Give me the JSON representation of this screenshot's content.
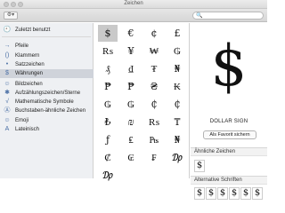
{
  "window": {
    "title": "Zeichen"
  },
  "toolbar": {
    "gear_label": "⚙▾",
    "search_placeholder": ""
  },
  "sidebar": {
    "items": [
      {
        "icon": "🕘",
        "icon_name": "clock-icon",
        "label": "Zuletzt benutzt",
        "selected": false
      },
      {
        "icon": "→",
        "icon_name": "arrow-icon",
        "label": "Pfeile",
        "selected": false
      },
      {
        "icon": "()",
        "icon_name": "parentheses-icon",
        "label": "Klammern",
        "selected": false
      },
      {
        "icon": "•",
        "icon_name": "bullet-icon",
        "label": "Satzzeichen",
        "selected": false
      },
      {
        "icon": "$",
        "icon_name": "dollar-icon",
        "label": "Währungen",
        "selected": true
      },
      {
        "icon": "☺",
        "icon_name": "pictograph-icon",
        "label": "Bildzeichen",
        "selected": false
      },
      {
        "icon": "✱",
        "icon_name": "star-icon",
        "label": "Aufzählungszeichen/Sterne",
        "selected": false
      },
      {
        "icon": "√",
        "icon_name": "math-icon",
        "label": "Mathematische Symbole",
        "selected": false
      },
      {
        "icon": "Ⓐ",
        "icon_name": "letterlike-icon",
        "label": "Buchstaben-ähnliche Zeichen",
        "selected": false
      },
      {
        "icon": "☺",
        "icon_name": "emoji-icon",
        "label": "Emoji",
        "selected": false
      },
      {
        "icon": "A",
        "icon_name": "latin-icon",
        "label": "Lateinisch",
        "selected": false
      }
    ]
  },
  "grid": {
    "rows": [
      [
        "$",
        "€",
        "¢",
        "£"
      ],
      [
        "₨",
        "¥",
        "₩",
        "₲"
      ],
      [
        "₰",
        "₫",
        "₮",
        "₦"
      ],
      [
        "₱",
        "₱",
        "₴",
        "₭"
      ],
      [
        "₲",
        "₲",
        "₵",
        "₵"
      ],
      [
        "₺",
        "₪",
        "₨",
        "₸"
      ],
      [
        "ƒ",
        "₤",
        "₧",
        "₦"
      ],
      [
        "₡",
        "₢",
        "₣",
        "₯"
      ],
      [
        "₯",
        "",
        "",
        ""
      ]
    ],
    "selected": [
      0,
      0
    ]
  },
  "detail": {
    "glyph": "$",
    "name": "DOLLAR SIGN",
    "favorite_label": "Als Favorit sichern",
    "similar_heading": "Ähnliche Zeichen",
    "similar_chars": [
      "$"
    ],
    "alt_fonts_heading": "Alternative Schriften",
    "alt_font_chars": [
      "$",
      "$",
      "$",
      "$",
      "$",
      "$"
    ]
  }
}
